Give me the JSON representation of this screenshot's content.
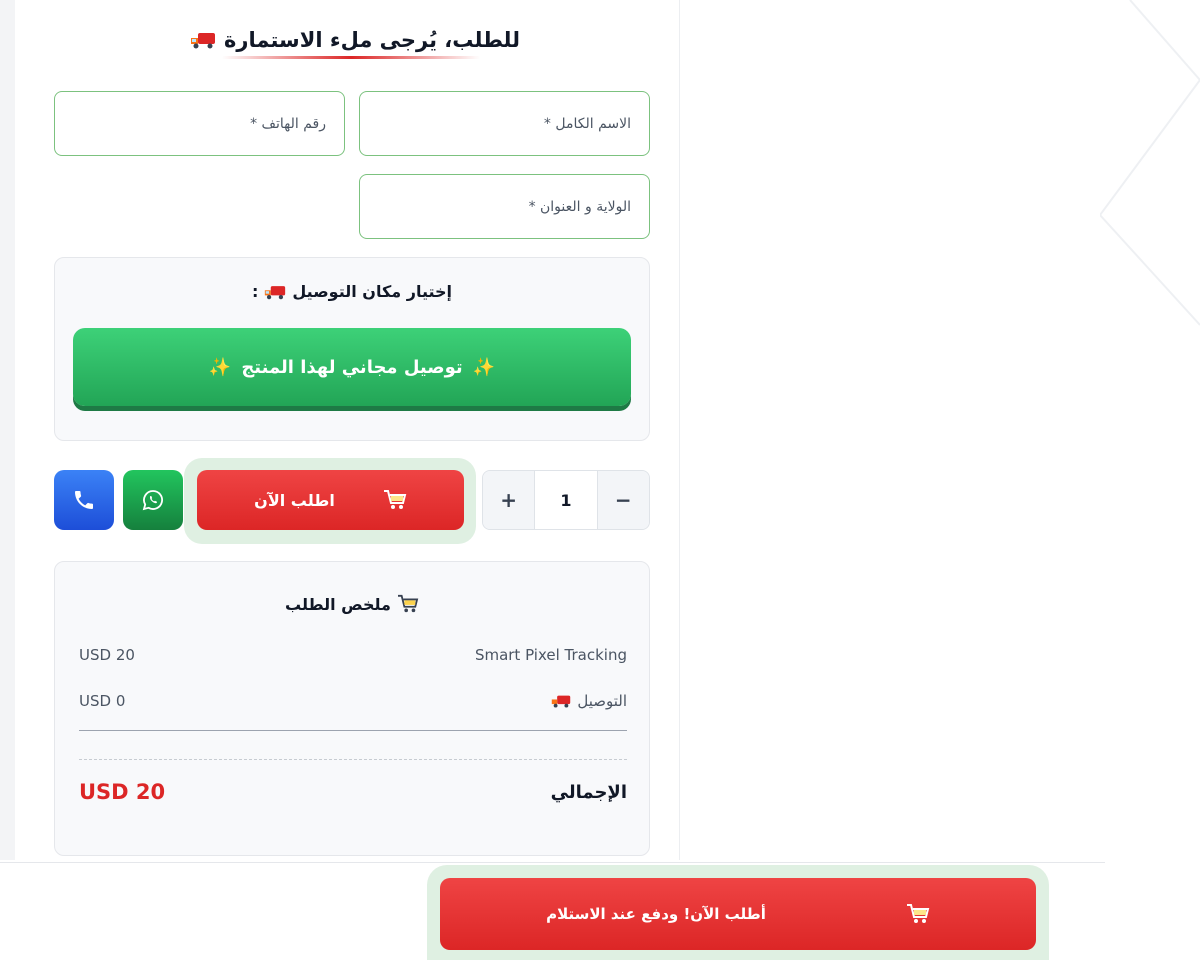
{
  "form": {
    "title": "للطلب، يُرجى ملء الاستمارة",
    "fields": {
      "full_name_placeholder": "الاسم الكامل *",
      "phone_placeholder": "رقم الهاتف *",
      "address_placeholder": "الولاية و العنوان *"
    }
  },
  "delivery": {
    "title": "إختيار مكان التوصيل",
    "title_suffix": ":",
    "free_option_label": "توصيل مجاني لهذا المنتج",
    "sparkle": "✨"
  },
  "actions": {
    "order_now_label": "اطلب الآن",
    "quantity": "1",
    "increment": "+",
    "decrement": "−"
  },
  "summary": {
    "title": "ملخص الطلب",
    "items": [
      {
        "name": "Smart Pixel Tracking",
        "price": "USD 20"
      },
      {
        "name": "التوصيل",
        "price": "USD 0"
      }
    ],
    "total_label": "الإجمالي",
    "total_value": "USD 20"
  },
  "sticky": {
    "label": "أطلب الآن! ودفع عند الاستلام"
  },
  "colors": {
    "field_border": "#7cc27f",
    "green_button": "#22a556",
    "red_button": "#dc2626",
    "whatsapp": "#16a34a",
    "phone": "#2563eb",
    "halo": "#dff0e2"
  },
  "icons": [
    "truck-icon",
    "sparkle-icon",
    "cart-icon",
    "whatsapp-icon",
    "phone-icon"
  ]
}
